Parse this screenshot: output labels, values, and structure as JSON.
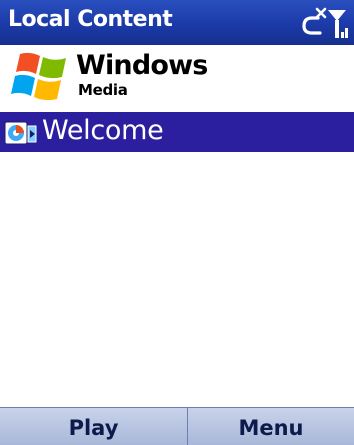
{
  "window": {
    "title": "Local Content"
  },
  "status": {
    "icons": [
      "connectivity-off-icon",
      "signal-strength-icon"
    ]
  },
  "logo": {
    "word1": "Windows",
    "word2": "Media",
    "flag_colors": [
      "#f25022",
      "#7fba00",
      "#00a4ef",
      "#ffb900"
    ]
  },
  "list": {
    "items": [
      {
        "label": "Welcome",
        "icon": "media-file-icon",
        "selected": true
      }
    ]
  },
  "softkeys": {
    "left": "Play",
    "right": "Menu"
  },
  "colors": {
    "title_bar": "#1c3aa8",
    "selection": "#2b1fa0",
    "softkey_bg": "#b8c4e2"
  }
}
